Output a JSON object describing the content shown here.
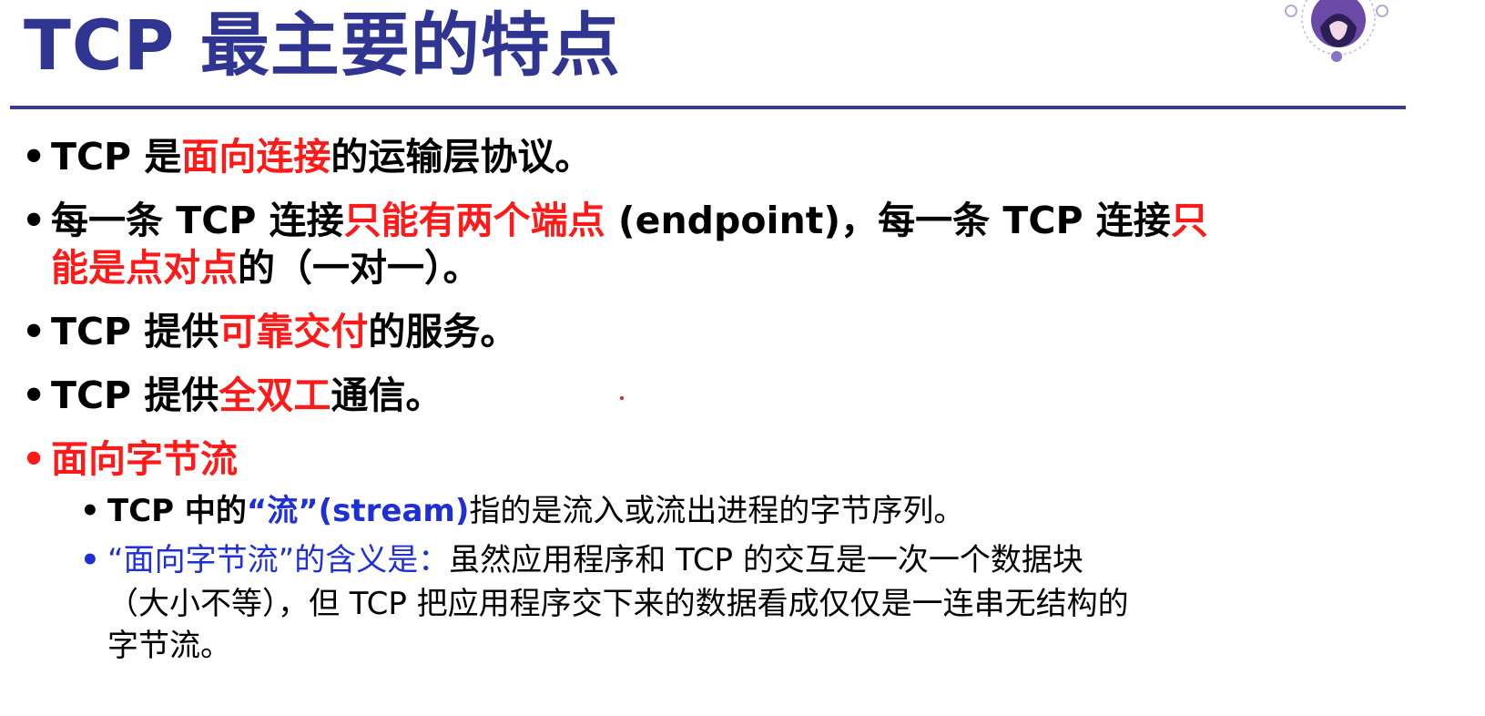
{
  "title": "TCP 最主要的特点",
  "colors": {
    "title": "#2f3590",
    "highlight_red": "#ff1a1a",
    "highlight_blue": "#1f2fd6",
    "divider": "#383d8a"
  },
  "bullet_glyph": "•",
  "bullets": [
    {
      "parts": [
        "TCP 是",
        "面向连接",
        "的运输层协议。"
      ]
    },
    {
      "line1": [
        "每一条 TCP 连接",
        "只能有两个端点",
        " (endpoint)，每一条 TCP 连接",
        "只"
      ],
      "line2": [
        "能是点对点",
        "的（一对一）。"
      ]
    },
    {
      "parts": [
        "TCP 提供",
        "可靠交付",
        "的服务。"
      ]
    },
    {
      "parts": [
        "TCP 提供",
        "全双工",
        "通信。"
      ]
    },
    {
      "text": "面向字节流",
      "sub": [
        {
          "parts": [
            "TCP 中的",
            "“流”",
            "(stream)",
            "指的是流入或流出进程的字节序列。"
          ]
        },
        {
          "line1": [
            "“面向字节流”的含义是：",
            "虽然应用程序和 TCP 的交互是一次一个数据块"
          ],
          "line2": "（大小不等），但 TCP 把应用程序交下来的数据看成仅仅是一连串无结构的",
          "line3": "字节流。"
        }
      ]
    }
  ]
}
